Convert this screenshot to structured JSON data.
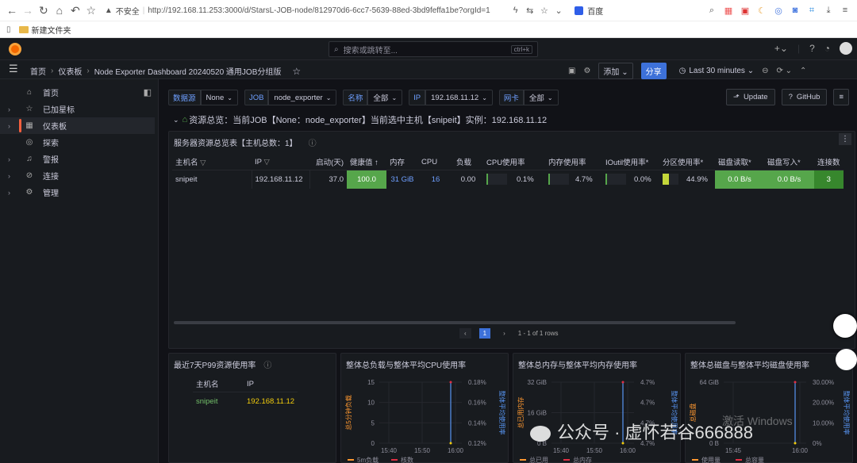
{
  "browser": {
    "security": "不安全",
    "url": "http://192.168.11.253:3000/d/StarsL-JOB-node/812970d6-6cc7-5639-88ed-3bd9feffa1be?orgId=1",
    "search_engine": "百度",
    "bookmark_folder": "新建文件夹"
  },
  "grafana": {
    "search_placeholder": "搜索或跳转至...",
    "search_kbd": "ctrl+k",
    "breadcrumb": [
      "首页",
      "仪表板",
      "Node Exporter Dashboard 20240520 通用JOB分组版"
    ],
    "add_label": "添加",
    "share_label": "分享",
    "time_range": "Last 30 minutes"
  },
  "sidebar": {
    "items": [
      {
        "label": "首页",
        "icon": "home-icon",
        "chev": ""
      },
      {
        "label": "已加星标",
        "icon": "star-icon",
        "chev": "›"
      },
      {
        "label": "仪表板",
        "icon": "dashboard-icon",
        "chev": "›"
      },
      {
        "label": "探索",
        "icon": "compass-icon",
        "chev": ""
      },
      {
        "label": "警报",
        "icon": "bell-icon",
        "chev": "›"
      },
      {
        "label": "连接",
        "icon": "link-icon",
        "chev": "›"
      },
      {
        "label": "管理",
        "icon": "gear-icon",
        "chev": "›"
      }
    ]
  },
  "variables": [
    {
      "label": "数据源",
      "value": "None"
    },
    {
      "label": "JOB",
      "value": "node_exporter"
    },
    {
      "label": "名称",
      "value": "全部"
    },
    {
      "label": "IP",
      "value": "192.168.11.12"
    },
    {
      "label": "网卡",
      "value": "全部"
    }
  ],
  "buttons": {
    "update": "Update",
    "github": "GitHub"
  },
  "row_title": "资源总览：当前JOB【None：node_exporter】当前选中主机【snipeit】实例：192.168.11.12",
  "overview": {
    "title": "服务器资源总览表【主机总数：1】",
    "headers": [
      "主机名",
      "IP",
      "启动(天)",
      "健康值",
      "内存",
      "CPU",
      "负载",
      "CPU使用率",
      "内存使用率",
      "IOutil使用率*",
      "分区使用率*",
      "磁盘读取*",
      "磁盘写入*",
      "连接数"
    ],
    "row": {
      "host": "snipeit",
      "ip": "192.168.11.12",
      "uptime": "37.0",
      "health": "100.0",
      "mem": "31 GiB",
      "cpu": "16",
      "load": "0.00",
      "cpu_pct": "0.1%",
      "mem_pct": "4.7%",
      "io_pct": "0.0%",
      "part_pct": "44.9%",
      "disk_read": "0.0 B/s",
      "disk_write": "0.0 B/s",
      "conn": "3"
    },
    "pagination": {
      "page": "1",
      "summary": "1 - 1 of 1 rows"
    }
  },
  "p99": {
    "title": "最近7天P99资源使用率",
    "headers": [
      "主机名",
      "IP"
    ],
    "row": {
      "host": "snipeit",
      "ip": "192.168.11.12"
    }
  },
  "charts_text": {
    "cpu_title": "整体总负载与整体平均CPU使用率",
    "mem_title": "整体总内存与整体平均内存使用率",
    "disk_title": "整体总磁盘与整体平均磁盘使用率",
    "cpu_left_label": "总5分钟负载",
    "cpu_right_label": "整体平均使用率",
    "mem_left_label": "总已用内存",
    "mem_right_label": "整体平均使用率",
    "disk_left_label": "总磁盘",
    "disk_right_label": "整体平均使用率",
    "cpu_legend": [
      "5m负载",
      "核数"
    ],
    "mem_legend": [
      "总已用",
      "总内存"
    ],
    "disk_legend": [
      "使用量",
      "总容量"
    ]
  },
  "chart_data": [
    {
      "type": "line",
      "title": "整体总负载与整体平均CPU使用率",
      "x_ticks": [
        "15:40",
        "15:50",
        "16:00"
      ],
      "y_ticks": [
        "0",
        "5",
        "10",
        "15"
      ],
      "y2_ticks": [
        "0.12%",
        "0.14%",
        "0.16%",
        "0.18%"
      ],
      "series": [
        {
          "name": "5m负载",
          "values": [
            0,
            0,
            0
          ]
        },
        {
          "name": "核数",
          "values": [
            16,
            16,
            16
          ]
        }
      ]
    },
    {
      "type": "line",
      "title": "整体总内存与整体平均内存使用率",
      "x_ticks": [
        "15:40",
        "15:50",
        "16:00"
      ],
      "y_ticks": [
        "0 B",
        "16 GiB",
        "32 GiB"
      ],
      "y2_ticks": [
        "4.7%",
        "4.7%",
        "4.7%",
        "4.7%"
      ],
      "series": [
        {
          "name": "总已用",
          "values": [
            1.5,
            1.5,
            1.5
          ]
        },
        {
          "name": "总内存",
          "values": [
            31,
            31,
            31
          ]
        }
      ]
    },
    {
      "type": "line",
      "title": "整体总磁盘与整体平均磁盘使用率",
      "x_ticks": [
        "15:45",
        "16:00"
      ],
      "y_ticks": [
        "0 B",
        "64 GiB"
      ],
      "y2_ticks": [
        "0%",
        "10.00%",
        "20.00%",
        "30.00%"
      ],
      "series": [
        {
          "name": "使用量",
          "values": [
            28,
            28,
            28
          ]
        },
        {
          "name": "总容量",
          "values": [
            63,
            63,
            63
          ]
        }
      ]
    }
  ],
  "watermark": "公众号 · 虚怀若谷666888",
  "windows_watermark": "激活 Windows"
}
